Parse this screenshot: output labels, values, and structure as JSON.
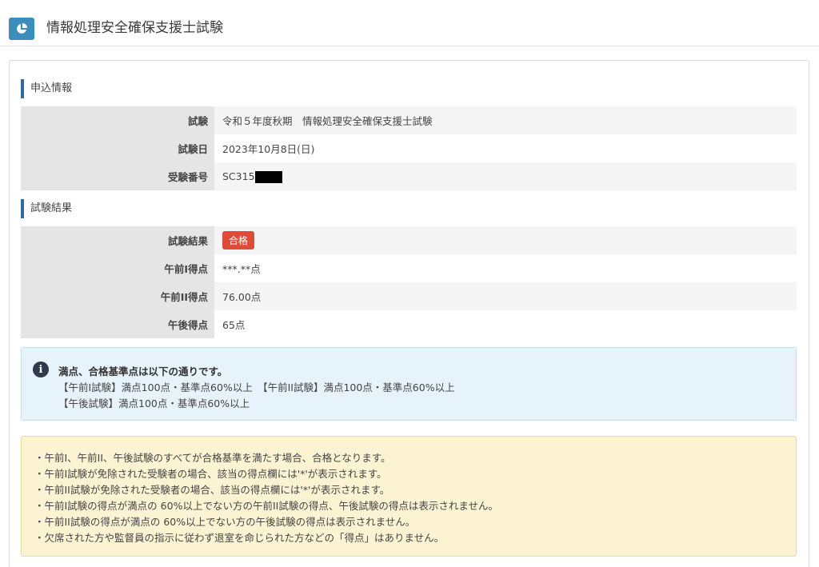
{
  "header": {
    "icon": "pie-chart-icon",
    "title": "情報処理安全確保支援士試験"
  },
  "application": {
    "section_title": "申込情報",
    "rows": [
      {
        "label": "試験",
        "value": "令和５年度秋期　情報処理安全確保支援士試験"
      },
      {
        "label": "試験日",
        "value": "2023年10月8日(日)"
      },
      {
        "label": "受験番号",
        "value": "SC315"
      }
    ]
  },
  "result": {
    "section_title": "試験結果",
    "result_label": "試験結果",
    "badge": "合格",
    "badge_color": "#dd4b39",
    "rows": [
      {
        "label": "午前I得点",
        "value": "***.**点"
      },
      {
        "label": "午前II得点",
        "value": "76.00点"
      },
      {
        "label": "午後得点",
        "value": "65点"
      }
    ]
  },
  "info_box": {
    "icon": "info-circle-icon",
    "heading": "満点、合格基準点は以下の通りです。",
    "lines": [
      "【午前I試験】満点100点・基準点60%以上　【午前II試験】満点100点・基準点60%以上",
      "【午後試験】満点100点・基準点60%以上"
    ]
  },
  "notes": [
    "・午前I、午前II、午後試験のすべてが合格基準を満たす場合、合格となります。",
    "・午前I試験が免除された受験者の場合、該当の得点欄には'*'が表示されます。",
    "・午前II試験が免除された受験者の場合、該当の得点欄には'*'が表示されます。",
    "・午前I試験の得点が満点の 60%以上でない方の午前II試験の得点、午後試験の得点は表示されません。",
    "・午前II試験の得点が満点の 60%以上でない方の午後試験の得点は表示されません。",
    "・欠席された方や監督員の指示に従わず退室を命じられた方などの「得点」はありません。"
  ],
  "colors": {
    "accent": "#3c8dbc",
    "section_bar": "#2f6aa5",
    "info_bg": "#e6f3fa",
    "warning_bg": "#fcf3d3"
  }
}
